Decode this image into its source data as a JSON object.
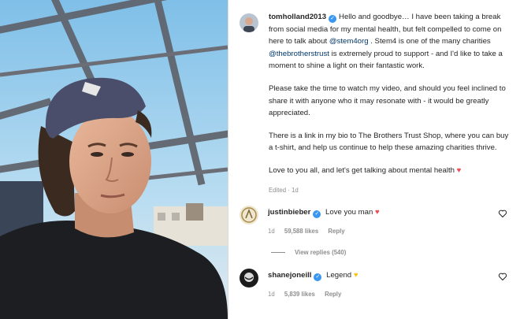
{
  "post": {
    "author": "tomholland2013",
    "caption": {
      "p1_a": "Hello and goodbye… I have been taking a break from social media for my mental health, but felt compelled to come on here to talk about ",
      "mention1": "@stem4org",
      "p1_b": " . Stem4 is one of the many charities ",
      "mention2": "@thebrotherstrust",
      "p1_c": " is extremely proud to support - and I'd like to take a moment to shine a light on their fantastic work.",
      "p2": "Please take the time to watch my video, and should you feel inclined to share it with anyone who it may resonate with - it would be greatly appreciated.",
      "p3": "There is a link in my bio to The Brothers Trust Shop, where you can buy a t-shirt, and help us continue to help these amazing charities thrive.",
      "p4": "Love to you all, and let's get talking about mental health",
      "p4_emoji": "♥"
    },
    "meta": "Edited · 1d"
  },
  "comments": [
    {
      "username": "justinbieber",
      "text": "Love you man",
      "emoji": "♥",
      "time": "1d",
      "likes": "59,588 likes",
      "reply": "Reply",
      "view_replies": "View replies (540)"
    },
    {
      "username": "shanejoneill",
      "text": "Legend",
      "emoji": "♥",
      "time": "1d",
      "likes": "5,839 likes",
      "reply": "Reply"
    }
  ],
  "icons": {
    "verified": "verified-badge-icon",
    "like": "heart-outline-icon"
  },
  "colors": {
    "link": "#00376b",
    "verified": "#3897f0",
    "red_heart": "#ed4956",
    "yellow_heart": "#f5c518"
  }
}
